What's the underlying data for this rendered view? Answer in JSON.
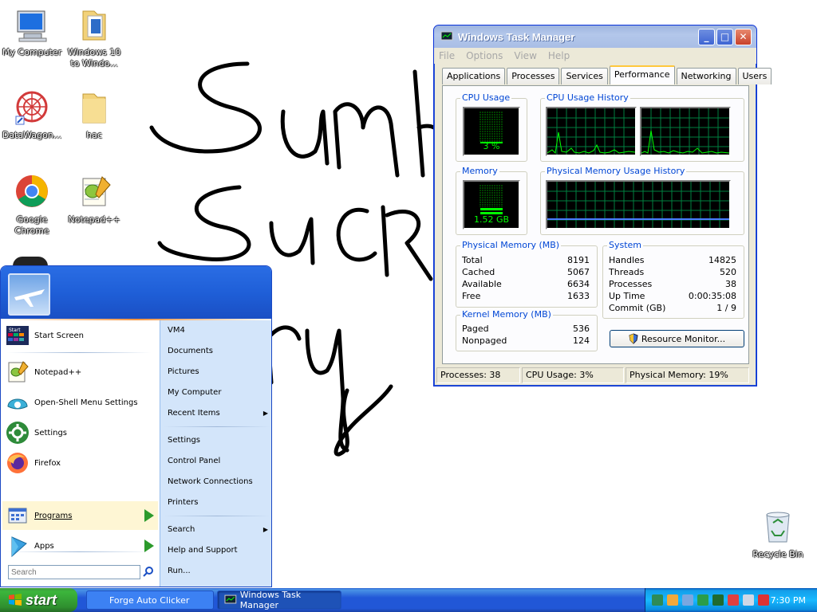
{
  "desktop": {
    "icons": [
      {
        "label": "My Computer"
      },
      {
        "label": "Windows 10 to Windo..."
      },
      {
        "label": "DataWagon..."
      },
      {
        "label": "hac"
      },
      {
        "label": "Google Chrome"
      },
      {
        "label": "Notepad++"
      },
      {
        "label": "Recycle Bin"
      }
    ]
  },
  "taskmgr": {
    "title": "Windows Task Manager",
    "menu": [
      "File",
      "Options",
      "View",
      "Help"
    ],
    "tabs": [
      "Applications",
      "Processes",
      "Services",
      "Performance",
      "Networking",
      "Users"
    ],
    "active_tab": "Performance",
    "cpu_usage_label": "CPU Usage",
    "cpu_usage_value": "3 %",
    "cpu_history_label": "CPU Usage History",
    "memory_label": "Memory",
    "memory_value": "1.52 GB",
    "phys_history_label": "Physical Memory Usage History",
    "physical_memory": {
      "title": "Physical Memory (MB)",
      "rows": [
        {
          "k": "Total",
          "v": "8191"
        },
        {
          "k": "Cached",
          "v": "5067"
        },
        {
          "k": "Available",
          "v": "6634"
        },
        {
          "k": "Free",
          "v": "1633"
        }
      ]
    },
    "kernel_memory": {
      "title": "Kernel Memory (MB)",
      "rows": [
        {
          "k": "Paged",
          "v": "536"
        },
        {
          "k": "Nonpaged",
          "v": "124"
        }
      ]
    },
    "system": {
      "title": "System",
      "rows": [
        {
          "k": "Handles",
          "v": "14825"
        },
        {
          "k": "Threads",
          "v": "520"
        },
        {
          "k": "Processes",
          "v": "38"
        },
        {
          "k": "Up Time",
          "v": "0:00:35:08"
        },
        {
          "k": "Commit (GB)",
          "v": "1 / 9"
        }
      ]
    },
    "resource_monitor_label": "Resource Monitor...",
    "status": {
      "processes": "Processes: 38",
      "cpu": "CPU Usage: 3%",
      "memory": "Physical Memory: 19%"
    }
  },
  "startmenu": {
    "left_items": [
      {
        "label": "Start Screen"
      },
      {
        "label": "Notepad++"
      },
      {
        "label": "Open-Shell Menu Settings"
      },
      {
        "label": "Settings"
      },
      {
        "label": "Firefox"
      },
      {
        "label": "Programs"
      },
      {
        "label": "Apps"
      }
    ],
    "right_items": [
      {
        "label": "VM4"
      },
      {
        "label": "Documents"
      },
      {
        "label": "Pictures"
      },
      {
        "label": "My Computer"
      },
      {
        "label": "Recent Items"
      },
      {
        "label": "Settings"
      },
      {
        "label": "Control Panel"
      },
      {
        "label": "Network Connections"
      },
      {
        "label": "Printers"
      },
      {
        "label": "Search"
      },
      {
        "label": "Help and Support"
      },
      {
        "label": "Run..."
      }
    ],
    "search_placeholder": "Search",
    "start_screen_tile": "Start"
  },
  "taskbar": {
    "start_label": "start",
    "buttons": [
      {
        "label": "Forge Auto Clicker"
      },
      {
        "label": "Windows Task Manager"
      }
    ],
    "clock": "7:30 PM"
  },
  "colors": {
    "taskbar_blue": "#2157d7",
    "start_green": "#3cb63c",
    "meter_green": "#00ff00",
    "group_title_blue": "#0046d5"
  }
}
